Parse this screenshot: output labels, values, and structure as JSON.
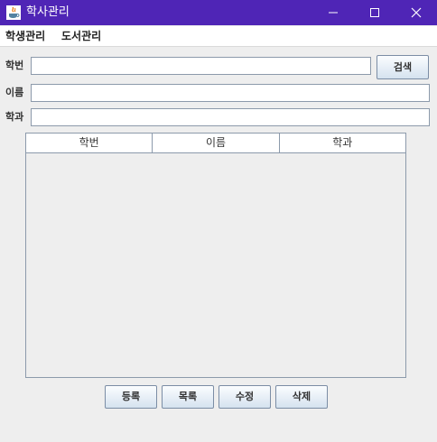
{
  "window": {
    "title": "학사관리",
    "controls": {
      "minimize": "minimize",
      "maximize": "maximize",
      "close": "close"
    },
    "titlebar_color": "#4f25b6"
  },
  "menu": {
    "items": [
      "학생관리",
      "도서관리"
    ]
  },
  "form": {
    "student_id": {
      "label": "학번",
      "value": ""
    },
    "name": {
      "label": "이름",
      "value": ""
    },
    "department": {
      "label": "학과",
      "value": ""
    },
    "search_label": "검색"
  },
  "table": {
    "columns": [
      "학번",
      "이름",
      "학과"
    ],
    "rows": []
  },
  "actions": {
    "register_label": "등록",
    "list_label": "목록",
    "edit_label": "수정",
    "delete_label": "삭제"
  },
  "icons": {
    "app": "java-cup-icon"
  }
}
